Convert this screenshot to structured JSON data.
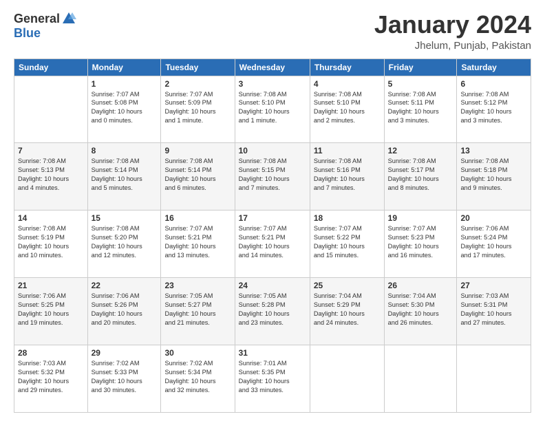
{
  "logo": {
    "general": "General",
    "blue": "Blue"
  },
  "header": {
    "month": "January 2024",
    "location": "Jhelum, Punjab, Pakistan"
  },
  "days_of_week": [
    "Sunday",
    "Monday",
    "Tuesday",
    "Wednesday",
    "Thursday",
    "Friday",
    "Saturday"
  ],
  "weeks": [
    [
      {
        "num": "",
        "info": ""
      },
      {
        "num": "1",
        "info": "Sunrise: 7:07 AM\nSunset: 5:08 PM\nDaylight: 10 hours\nand 0 minutes."
      },
      {
        "num": "2",
        "info": "Sunrise: 7:07 AM\nSunset: 5:09 PM\nDaylight: 10 hours\nand 1 minute."
      },
      {
        "num": "3",
        "info": "Sunrise: 7:08 AM\nSunset: 5:10 PM\nDaylight: 10 hours\nand 1 minute."
      },
      {
        "num": "4",
        "info": "Sunrise: 7:08 AM\nSunset: 5:10 PM\nDaylight: 10 hours\nand 2 minutes."
      },
      {
        "num": "5",
        "info": "Sunrise: 7:08 AM\nSunset: 5:11 PM\nDaylight: 10 hours\nand 3 minutes."
      },
      {
        "num": "6",
        "info": "Sunrise: 7:08 AM\nSunset: 5:12 PM\nDaylight: 10 hours\nand 3 minutes."
      }
    ],
    [
      {
        "num": "7",
        "info": "Sunrise: 7:08 AM\nSunset: 5:13 PM\nDaylight: 10 hours\nand 4 minutes."
      },
      {
        "num": "8",
        "info": "Sunrise: 7:08 AM\nSunset: 5:14 PM\nDaylight: 10 hours\nand 5 minutes."
      },
      {
        "num": "9",
        "info": "Sunrise: 7:08 AM\nSunset: 5:14 PM\nDaylight: 10 hours\nand 6 minutes."
      },
      {
        "num": "10",
        "info": "Sunrise: 7:08 AM\nSunset: 5:15 PM\nDaylight: 10 hours\nand 7 minutes."
      },
      {
        "num": "11",
        "info": "Sunrise: 7:08 AM\nSunset: 5:16 PM\nDaylight: 10 hours\nand 7 minutes."
      },
      {
        "num": "12",
        "info": "Sunrise: 7:08 AM\nSunset: 5:17 PM\nDaylight: 10 hours\nand 8 minutes."
      },
      {
        "num": "13",
        "info": "Sunrise: 7:08 AM\nSunset: 5:18 PM\nDaylight: 10 hours\nand 9 minutes."
      }
    ],
    [
      {
        "num": "14",
        "info": "Sunrise: 7:08 AM\nSunset: 5:19 PM\nDaylight: 10 hours\nand 10 minutes."
      },
      {
        "num": "15",
        "info": "Sunrise: 7:08 AM\nSunset: 5:20 PM\nDaylight: 10 hours\nand 12 minutes."
      },
      {
        "num": "16",
        "info": "Sunrise: 7:07 AM\nSunset: 5:21 PM\nDaylight: 10 hours\nand 13 minutes."
      },
      {
        "num": "17",
        "info": "Sunrise: 7:07 AM\nSunset: 5:21 PM\nDaylight: 10 hours\nand 14 minutes."
      },
      {
        "num": "18",
        "info": "Sunrise: 7:07 AM\nSunset: 5:22 PM\nDaylight: 10 hours\nand 15 minutes."
      },
      {
        "num": "19",
        "info": "Sunrise: 7:07 AM\nSunset: 5:23 PM\nDaylight: 10 hours\nand 16 minutes."
      },
      {
        "num": "20",
        "info": "Sunrise: 7:06 AM\nSunset: 5:24 PM\nDaylight: 10 hours\nand 17 minutes."
      }
    ],
    [
      {
        "num": "21",
        "info": "Sunrise: 7:06 AM\nSunset: 5:25 PM\nDaylight: 10 hours\nand 19 minutes."
      },
      {
        "num": "22",
        "info": "Sunrise: 7:06 AM\nSunset: 5:26 PM\nDaylight: 10 hours\nand 20 minutes."
      },
      {
        "num": "23",
        "info": "Sunrise: 7:05 AM\nSunset: 5:27 PM\nDaylight: 10 hours\nand 21 minutes."
      },
      {
        "num": "24",
        "info": "Sunrise: 7:05 AM\nSunset: 5:28 PM\nDaylight: 10 hours\nand 23 minutes."
      },
      {
        "num": "25",
        "info": "Sunrise: 7:04 AM\nSunset: 5:29 PM\nDaylight: 10 hours\nand 24 minutes."
      },
      {
        "num": "26",
        "info": "Sunrise: 7:04 AM\nSunset: 5:30 PM\nDaylight: 10 hours\nand 26 minutes."
      },
      {
        "num": "27",
        "info": "Sunrise: 7:03 AM\nSunset: 5:31 PM\nDaylight: 10 hours\nand 27 minutes."
      }
    ],
    [
      {
        "num": "28",
        "info": "Sunrise: 7:03 AM\nSunset: 5:32 PM\nDaylight: 10 hours\nand 29 minutes."
      },
      {
        "num": "29",
        "info": "Sunrise: 7:02 AM\nSunset: 5:33 PM\nDaylight: 10 hours\nand 30 minutes."
      },
      {
        "num": "30",
        "info": "Sunrise: 7:02 AM\nSunset: 5:34 PM\nDaylight: 10 hours\nand 32 minutes."
      },
      {
        "num": "31",
        "info": "Sunrise: 7:01 AM\nSunset: 5:35 PM\nDaylight: 10 hours\nand 33 minutes."
      },
      {
        "num": "",
        "info": ""
      },
      {
        "num": "",
        "info": ""
      },
      {
        "num": "",
        "info": ""
      }
    ]
  ]
}
